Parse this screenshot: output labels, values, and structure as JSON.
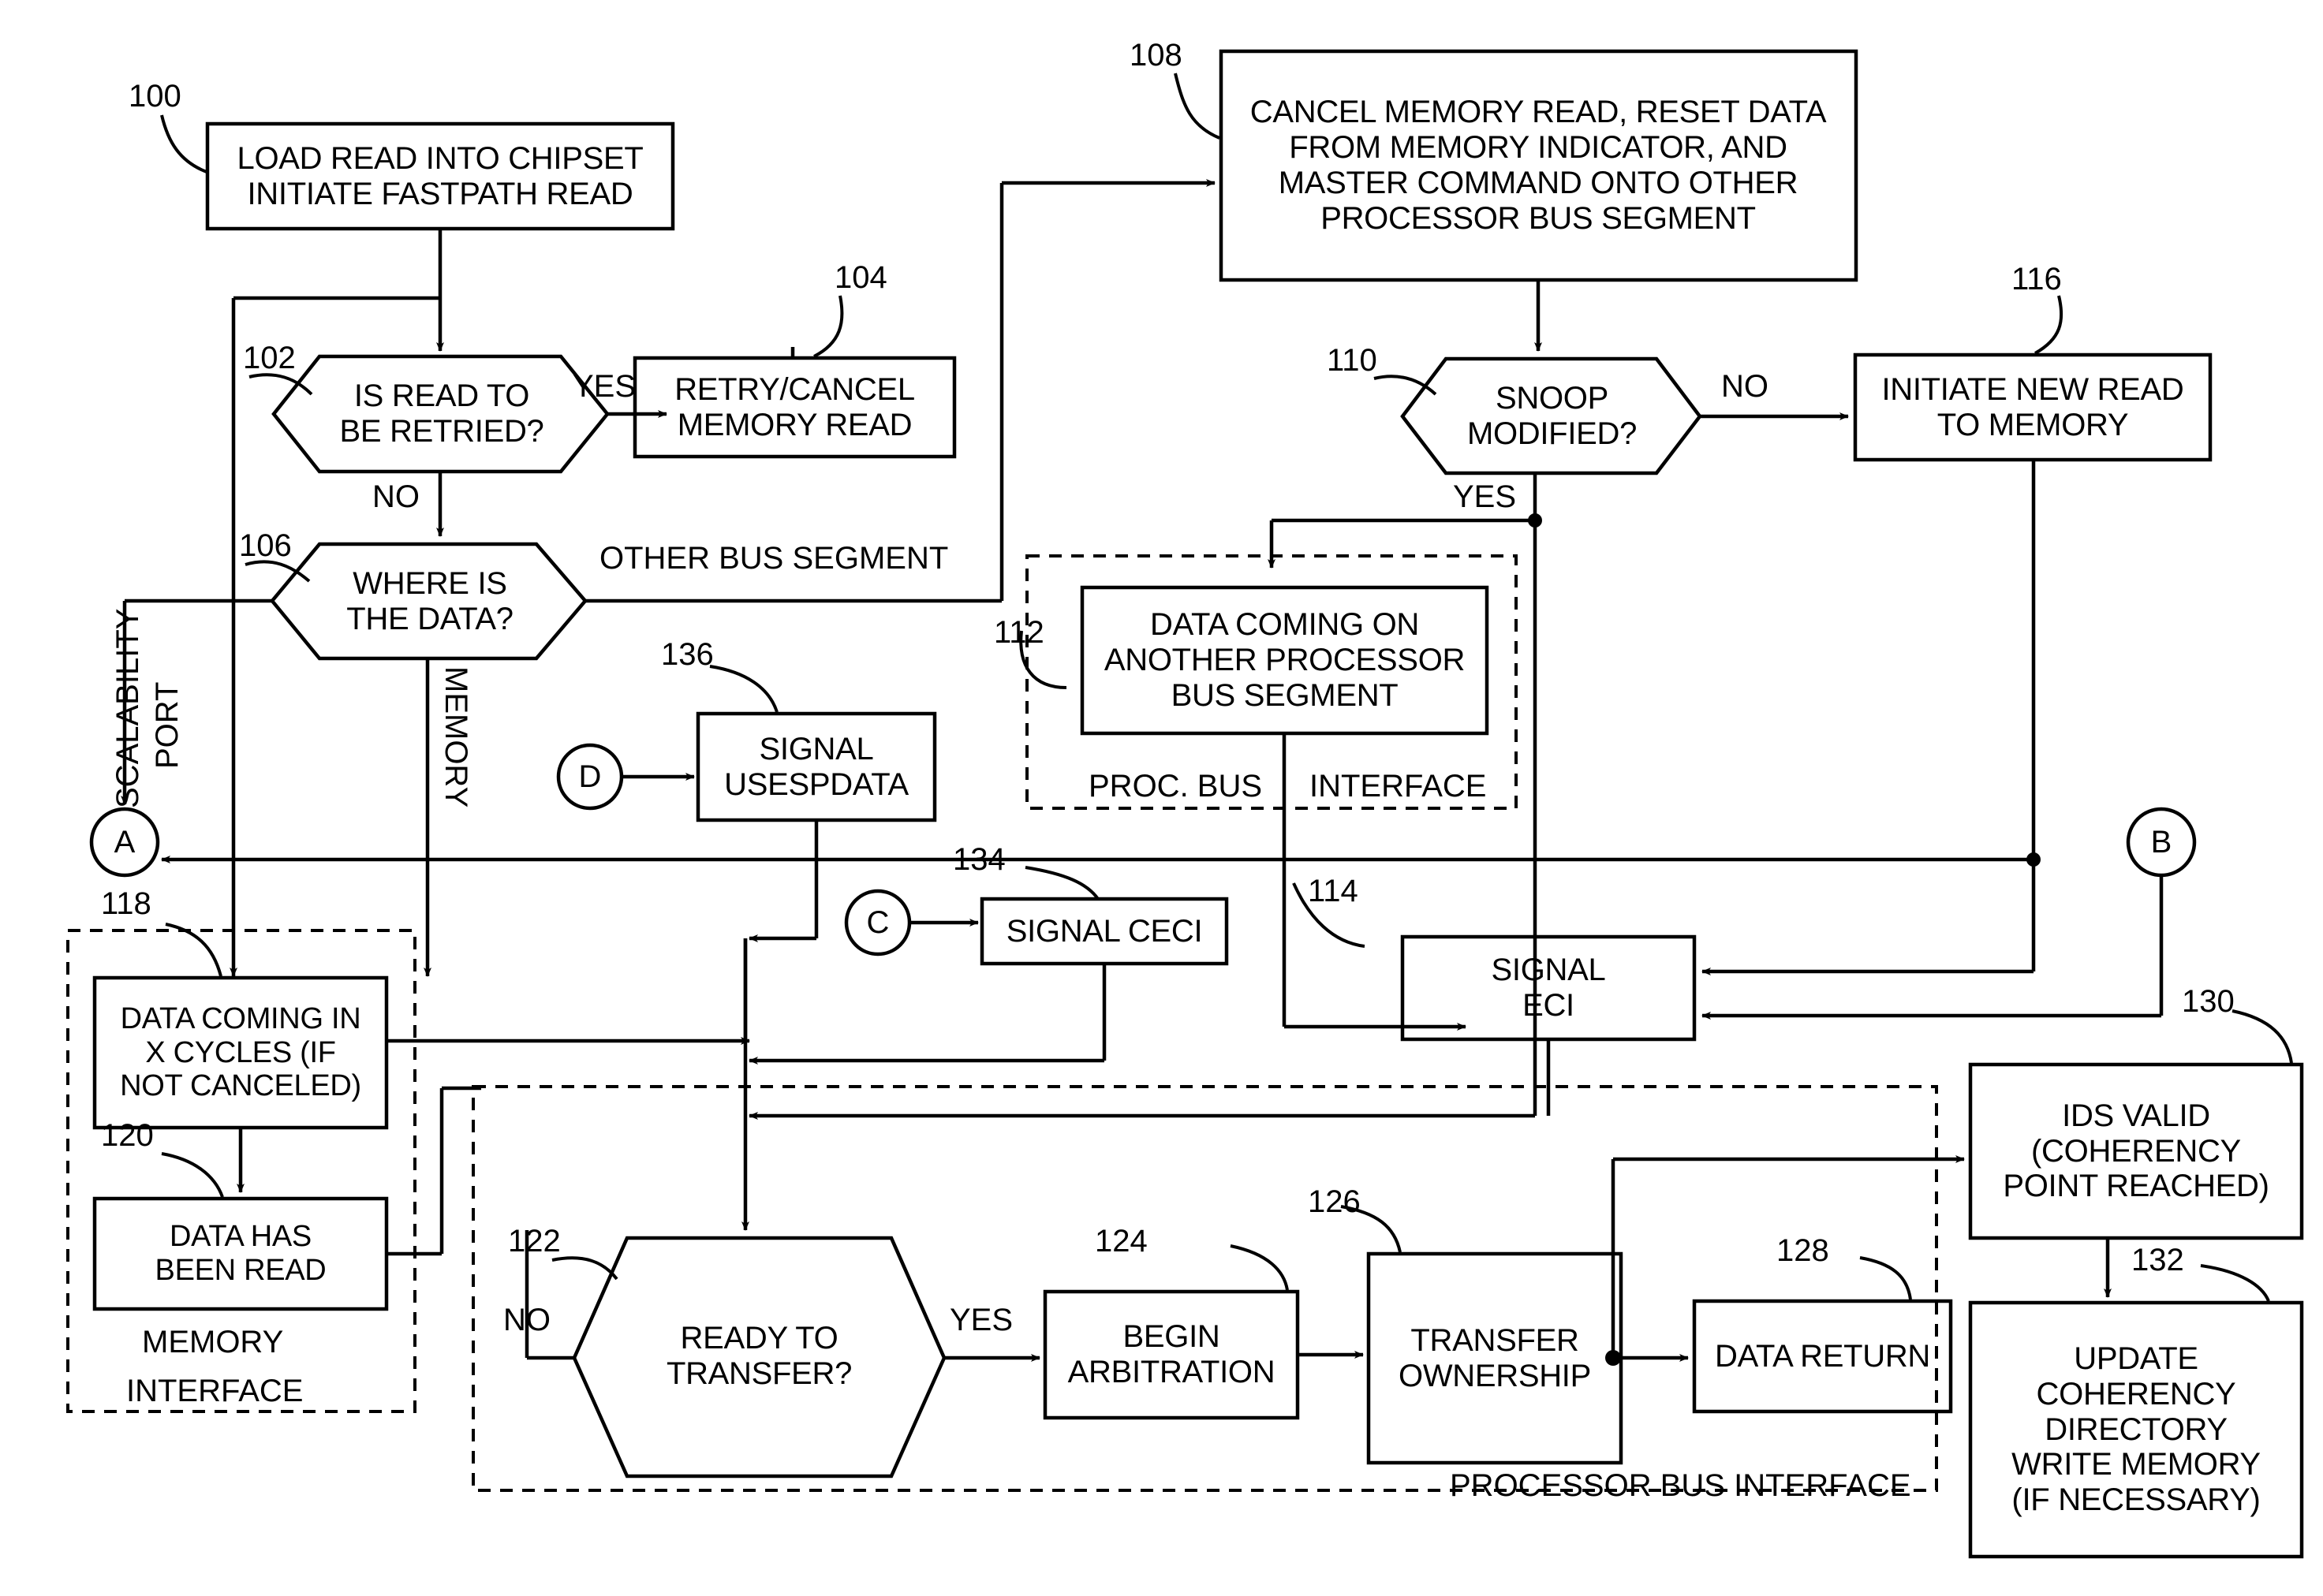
{
  "figure": {
    "kind": "patent-flowchart",
    "background": "#ffffff",
    "ink": "#000000"
  },
  "nodes": {
    "n100": {
      "ref": "100",
      "text": "LOAD READ INTO CHIPSET\nINITIATE FASTPATH READ",
      "shape": "process"
    },
    "n102": {
      "ref": "102",
      "text": "IS READ TO\nBE RETRIED?",
      "shape": "decision"
    },
    "n104": {
      "ref": "104",
      "text": "RETRY/CANCEL\nMEMORY READ",
      "shape": "process"
    },
    "n106": {
      "ref": "106",
      "text": "WHERE IS\nTHE DATA?",
      "shape": "decision"
    },
    "n108": {
      "ref": "108",
      "text": "CANCEL MEMORY READ, RESET DATA\nFROM MEMORY INDICATOR, AND\nMASTER COMMAND ONTO OTHER\nPROCESSOR BUS SEGMENT",
      "shape": "process"
    },
    "n110": {
      "ref": "110",
      "text": "SNOOP\nMODIFIED?",
      "shape": "decision"
    },
    "n112": {
      "ref": "112",
      "text": "DATA COMING ON\nANOTHER PROCESSOR\nBUS SEGMENT",
      "shape": "process"
    },
    "n114": {
      "ref": "114",
      "text": "SIGNAL\nECI",
      "shape": "process"
    },
    "n116": {
      "ref": "116",
      "text": "INITIATE NEW READ\nTO MEMORY",
      "shape": "process"
    },
    "n118": {
      "ref": "118",
      "text": "DATA COMING IN\nX CYCLES (IF\nNOT CANCELED)",
      "shape": "process"
    },
    "n120": {
      "ref": "120",
      "text": "DATA HAS\nBEEN READ",
      "shape": "process"
    },
    "n122": {
      "ref": "122",
      "text": "READY TO\nTRANSFER?",
      "shape": "decision"
    },
    "n124": {
      "ref": "124",
      "text": "BEGIN\nARBITRATION",
      "shape": "process"
    },
    "n126": {
      "ref": "126",
      "text": "TRANSFER\nOWNERSHIP",
      "shape": "process"
    },
    "n128": {
      "ref": "128",
      "text": "DATA RETURN",
      "shape": "process"
    },
    "n130": {
      "ref": "130",
      "text": "IDS VALID\n(COHERENCY\nPOINT REACHED)",
      "shape": "process"
    },
    "n132": {
      "ref": "132",
      "text": "UPDATE\nCOHERENCY\nDIRECTORY\nWRITE MEMORY\n(IF NECESSARY)",
      "shape": "process"
    },
    "n134": {
      "ref": "134",
      "text": "SIGNAL CECI",
      "shape": "process"
    },
    "n136": {
      "ref": "136",
      "text": "SIGNAL\nUSESPDATA",
      "shape": "process"
    }
  },
  "connectors": {
    "a": {
      "label": "A"
    },
    "b": {
      "label": "B"
    },
    "c": {
      "label": "C"
    },
    "d": {
      "label": "D"
    }
  },
  "edge_labels": {
    "retry_yes": "YES",
    "retry_no": "NO",
    "where_other": "OTHER BUS SEGMENT",
    "where_memory": "MEMORY",
    "where_scalability": "SCALABILITY\nPORT",
    "scalability_line1": "SCALABILITY",
    "scalability_line2": "PORT",
    "snoop_no": "NO",
    "snoop_yes": "YES",
    "transfer_no": "NO",
    "transfer_yes": "YES"
  },
  "zones": {
    "proc_bus_interface_top_left": "PROC. BUS",
    "proc_bus_interface_top_right": "INTERFACE",
    "memory_interface_line1": "MEMORY",
    "memory_interface_line2": "INTERFACE",
    "processor_bus_interface": "PROCESSOR BUS INTERFACE"
  },
  "refs": {
    "r100": "100",
    "r102": "102",
    "r104": "104",
    "r106": "106",
    "r108": "108",
    "r110": "110",
    "r112": "112",
    "r114": "114",
    "r116": "116",
    "r118": "118",
    "r120": "120",
    "r122": "122",
    "r124": "124",
    "r126": "126",
    "r128": "128",
    "r130": "130",
    "r132": "132",
    "r134": "134",
    "r136": "136"
  }
}
